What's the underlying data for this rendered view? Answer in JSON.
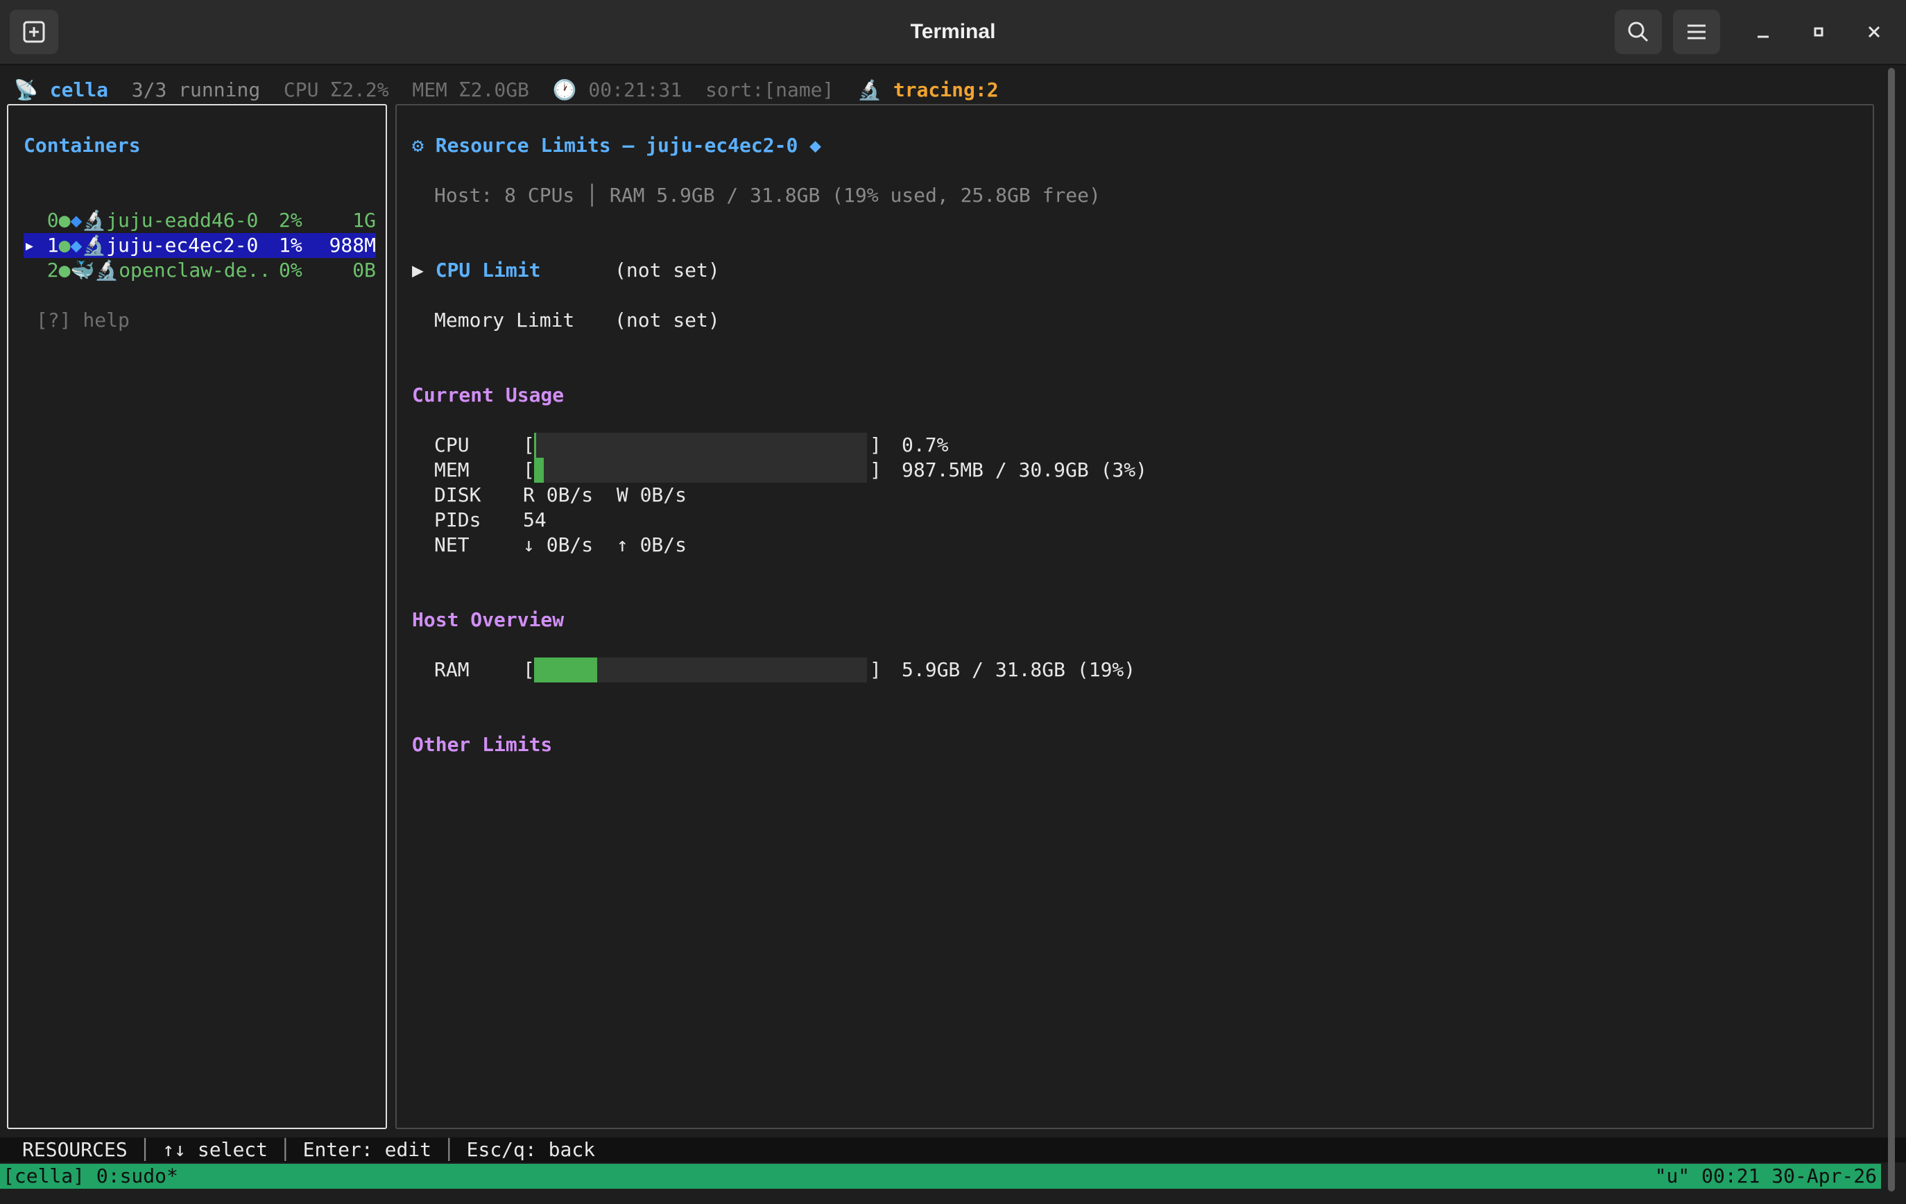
{
  "window": {
    "title": "Terminal",
    "icons": [
      "new-tab-icon",
      "search-icon",
      "menu-icon",
      "minimize-icon",
      "maximize-icon",
      "close-icon"
    ]
  },
  "status": {
    "app_name": "cella",
    "running": "3/3 running",
    "cpu": "CPU Σ2.2%",
    "mem": "MEM Σ2.0GB",
    "uptime": "00:21:31",
    "sort": "sort:[name]",
    "tracing": "tracing:2"
  },
  "containers": {
    "title": "Containers",
    "items": [
      {
        "index": "0",
        "name": "juju-eadd46-0",
        "cpu": "2%",
        "mem": "1G",
        "selected": false
      },
      {
        "index": "1",
        "name": "juju-ec4ec2-0",
        "cpu": "1%",
        "mem": "988M",
        "selected": true
      },
      {
        "index": "2",
        "name": "openclaw-de..",
        "cpu": "0%",
        "mem": "0B",
        "selected": false
      }
    ],
    "help": "[?] help"
  },
  "resources": {
    "title": "Resource Limits — juju-ec4ec2-0",
    "host_info": "Host: 8 CPUs │ RAM 5.9GB / 31.8GB (19% used, 25.8GB free)",
    "limits": [
      {
        "label": "CPU Limit",
        "value": "(not set)",
        "selected": true
      },
      {
        "label": "Memory Limit",
        "value": "(not set)",
        "selected": false
      }
    ],
    "current_usage": {
      "heading": "Current Usage",
      "cpu": {
        "label": "CPU",
        "value": "0.7%",
        "fill_fraction": 0.007
      },
      "mem": {
        "label": "MEM",
        "value": "987.5MB / 30.9GB (3%)",
        "fill_fraction": 0.03
      },
      "disk": {
        "label": "DISK",
        "value": "R 0B/s  W 0B/s"
      },
      "pids": {
        "label": "PIDs",
        "value": "54"
      },
      "net": {
        "label": "NET",
        "value": "↓ 0B/s  ↑ 0B/s"
      }
    },
    "host_overview": {
      "heading": "Host Overview",
      "ram": {
        "label": "RAM",
        "value": "5.9GB / 31.8GB (19%)",
        "fill_fraction": 0.19
      }
    },
    "other_limits": {
      "heading": "Other Limits"
    }
  },
  "hints": {
    "mode": "RESOURCES",
    "select": "↑↓ select",
    "edit": "Enter: edit",
    "back": "Esc/q: back"
  },
  "tmux": {
    "left": "[cella] 0:sudo*",
    "right": "\"u\" 00:21 30-Apr-26"
  },
  "colors": {
    "accent_blue": "#5cb1ff",
    "heading_purple": "#d18ff5",
    "running_green": "#6cc26c",
    "tracing_orange": "#f0a431",
    "selection_blue": "#1a1ab0",
    "tmux_green": "#21a366"
  }
}
